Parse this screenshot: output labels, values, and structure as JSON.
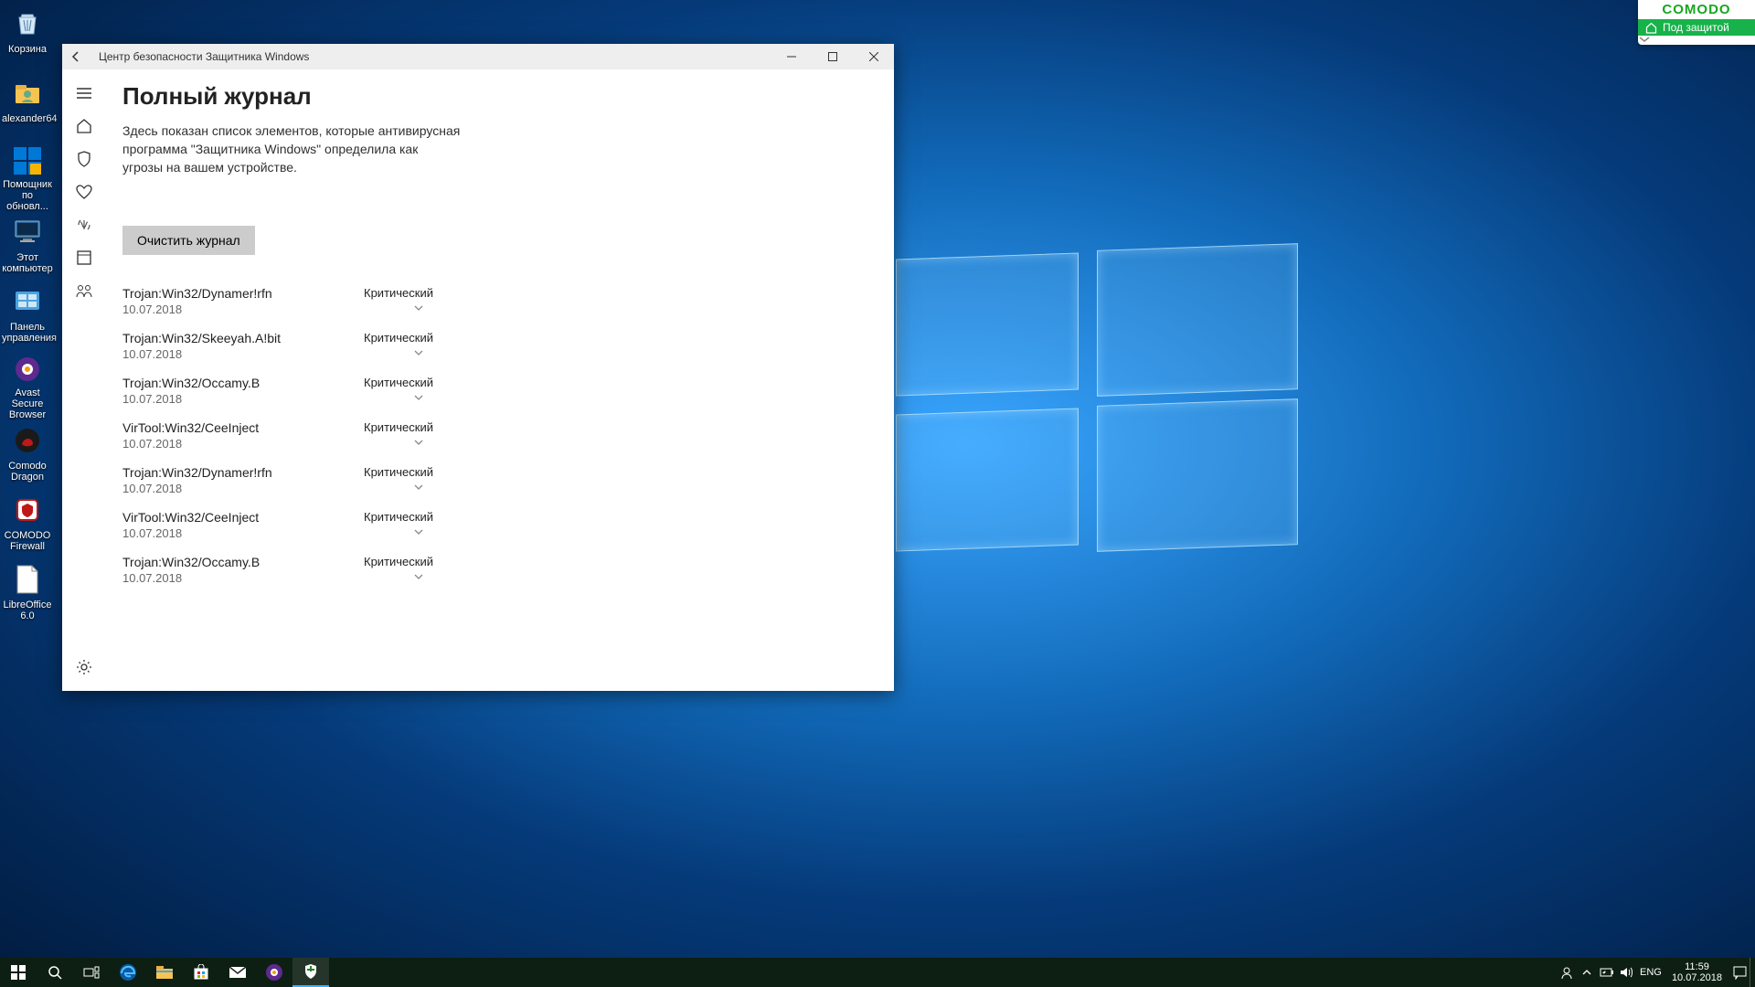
{
  "desktop": {
    "icons": [
      {
        "id": "recycle",
        "label": "Корзина"
      },
      {
        "id": "user",
        "label": "alexander64"
      },
      {
        "id": "updasst",
        "label": "Помощник по обновл..."
      },
      {
        "id": "thispc",
        "label": "Этот компьютер"
      },
      {
        "id": "cpanel",
        "label": "Панель управления"
      },
      {
        "id": "avast",
        "label": "Avast Secure Browser"
      },
      {
        "id": "dragon",
        "label": "Comodo Dragon"
      },
      {
        "id": "cfirewall",
        "label": "COMODO Firewall"
      },
      {
        "id": "libre",
        "label": "LibreOffice 6.0"
      }
    ]
  },
  "window": {
    "title": "Центр безопасности Защитника Windows",
    "page_title": "Полный журнал",
    "subtitle": "Здесь показан список элементов, которые антивирусная программа \"Защитника Windows\" определила как угрозы на вашем устройстве.",
    "clear_button": "Очистить журнал",
    "threats": [
      {
        "name": "Trojan:Win32/Dynamer!rfn",
        "date": "10.07.2018",
        "severity": "Критический"
      },
      {
        "name": "Trojan:Win32/Skeeyah.A!bit",
        "date": "10.07.2018",
        "severity": "Критический"
      },
      {
        "name": "Trojan:Win32/Occamy.B",
        "date": "10.07.2018",
        "severity": "Критический"
      },
      {
        "name": "VirTool:Win32/CeeInject",
        "date": "10.07.2018",
        "severity": "Критический"
      },
      {
        "name": "Trojan:Win32/Dynamer!rfn",
        "date": "10.07.2018",
        "severity": "Критический"
      },
      {
        "name": "VirTool:Win32/CeeInject",
        "date": "10.07.2018",
        "severity": "Критический"
      },
      {
        "name": "Trojan:Win32/Occamy.B",
        "date": "10.07.2018",
        "severity": "Критический"
      }
    ]
  },
  "comodo": {
    "brand": "COMODO",
    "status": "Под защитой"
  },
  "tray": {
    "lang": "ENG",
    "time": "11:59",
    "date": "10.07.2018"
  }
}
